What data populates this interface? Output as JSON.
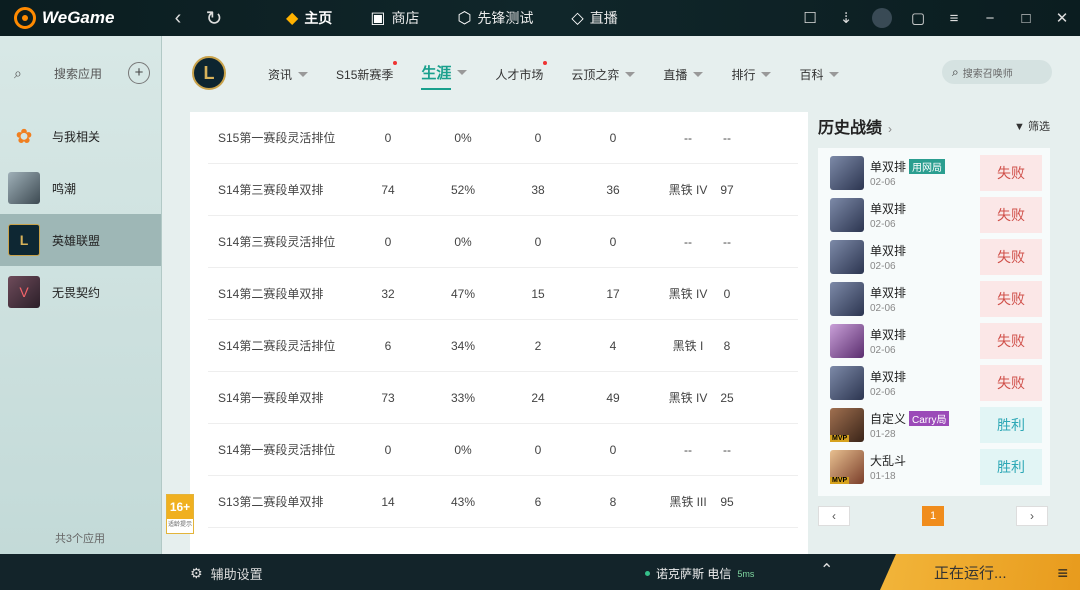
{
  "app": {
    "title": "WeGame"
  },
  "topnav": [
    {
      "label": "主页",
      "icon": "home-icon"
    },
    {
      "label": "商店",
      "icon": "bag-icon"
    },
    {
      "label": "先锋测试",
      "icon": "gamepad-icon"
    },
    {
      "label": "直播",
      "icon": "live-icon"
    }
  ],
  "sidebar": {
    "search_label": "搜索应用",
    "items": [
      {
        "label": "与我相关"
      },
      {
        "label": "鸣潮"
      },
      {
        "label": "英雄联盟"
      },
      {
        "label": "无畏契约"
      }
    ],
    "footer": "共3个应用"
  },
  "subnav": {
    "tabs": [
      {
        "label": "资讯"
      },
      {
        "label": "S15新赛季"
      },
      {
        "label": "生涯"
      },
      {
        "label": "人才市场"
      },
      {
        "label": "云顶之弈"
      },
      {
        "label": "直播"
      },
      {
        "label": "排行"
      },
      {
        "label": "百科"
      }
    ],
    "search_placeholder": "搜索召唤师"
  },
  "ranked": {
    "rows": [
      {
        "season": "S15第一赛段灵活排位",
        "games": "0",
        "winrate": "0%",
        "wins": "0",
        "losses": "0",
        "tier": "--",
        "points": "--"
      },
      {
        "season": "S14第三赛段单双排",
        "games": "74",
        "winrate": "52%",
        "wins": "38",
        "losses": "36",
        "tier": "黑铁 IV",
        "points": "97"
      },
      {
        "season": "S14第三赛段灵活排位",
        "games": "0",
        "winrate": "0%",
        "wins": "0",
        "losses": "0",
        "tier": "--",
        "points": "--"
      },
      {
        "season": "S14第二赛段单双排",
        "games": "32",
        "winrate": "47%",
        "wins": "15",
        "losses": "17",
        "tier": "黑铁 IV",
        "points": "0"
      },
      {
        "season": "S14第二赛段灵活排位",
        "games": "6",
        "winrate": "34%",
        "wins": "2",
        "losses": "4",
        "tier": "黑铁 I",
        "points": "8"
      },
      {
        "season": "S14第一赛段单双排",
        "games": "73",
        "winrate": "33%",
        "wins": "24",
        "losses": "49",
        "tier": "黑铁 IV",
        "points": "25"
      },
      {
        "season": "S14第一赛段灵活排位",
        "games": "0",
        "winrate": "0%",
        "wins": "0",
        "losses": "0",
        "tier": "--",
        "points": "--"
      },
      {
        "season": "S13第二赛段单双排",
        "games": "14",
        "winrate": "43%",
        "wins": "6",
        "losses": "8",
        "tier": "黑铁 III",
        "points": "95"
      }
    ]
  },
  "history": {
    "title": "历史战绩",
    "filter": "筛选",
    "matches": [
      {
        "mode": "单双排",
        "tag": "用网局",
        "date": "02-06",
        "result": "失败",
        "outcome": "lose"
      },
      {
        "mode": "单双排",
        "tag": "",
        "date": "02-06",
        "result": "失败",
        "outcome": "lose"
      },
      {
        "mode": "单双排",
        "tag": "",
        "date": "02-06",
        "result": "失败",
        "outcome": "lose"
      },
      {
        "mode": "单双排",
        "tag": "",
        "date": "02-06",
        "result": "失败",
        "outcome": "lose"
      },
      {
        "mode": "单双排",
        "tag": "",
        "date": "02-06",
        "result": "失败",
        "outcome": "lose"
      },
      {
        "mode": "单双排",
        "tag": "",
        "date": "02-06",
        "result": "失败",
        "outcome": "lose"
      },
      {
        "mode": "自定义",
        "tag": "Carry局",
        "date": "01-28",
        "result": "胜利",
        "outcome": "win",
        "mvp": "MVP"
      },
      {
        "mode": "大乱斗",
        "tag": "",
        "date": "01-18",
        "result": "胜利",
        "outcome": "win",
        "mvp": "MVP"
      }
    ],
    "page": "1",
    "prev": "‹",
    "next": "›"
  },
  "age_rating": {
    "number": "16+",
    "text": "适龄提示"
  },
  "bottombar": {
    "assist": "辅助设置",
    "server": "诺克萨斯 电信",
    "ping": "5ms",
    "running": "正在运行..."
  }
}
